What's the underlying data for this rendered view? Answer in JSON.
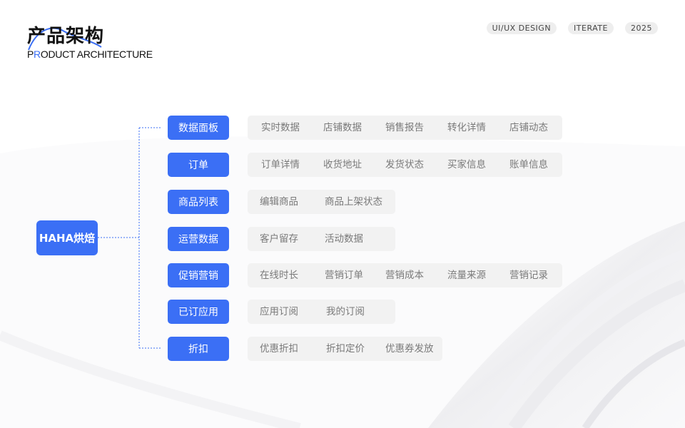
{
  "header": {
    "title_cn": "产品架构",
    "title_en_first": "P",
    "title_en_second": "R",
    "title_en_rest": "ODUCT ARCHITECTURE",
    "tags": [
      "UI/UX DESIGN",
      "ITERATE",
      "2025"
    ]
  },
  "colors": {
    "accent": "#3b6ff5",
    "item_bg": "#f2f2f2",
    "item_text": "#7a7a7a"
  },
  "root": {
    "label": "HAHA烘焙"
  },
  "categories": [
    {
      "label": "数据面板",
      "items": [
        "实时数据",
        "店铺数据",
        "销售报告",
        "转化详情",
        "店铺动态"
      ]
    },
    {
      "label": "订单",
      "items": [
        "订单详情",
        "收货地址",
        "发货状态",
        "买家信息",
        "账单信息"
      ]
    },
    {
      "label": "商品列表",
      "items": [
        "编辑商品",
        "商品上架状态"
      ]
    },
    {
      "label": "运营数据",
      "items": [
        "客户留存",
        "活动数据"
      ]
    },
    {
      "label": "促销营销",
      "items": [
        "在线时长",
        "营销订单",
        "营销成本",
        "流量来源",
        "营销记录"
      ]
    },
    {
      "label": "已订应用",
      "items": [
        "应用订阅",
        "我的订阅"
      ]
    },
    {
      "label": "折扣",
      "items": [
        "优惠折扣",
        "折扣定价",
        "优惠券发放"
      ]
    }
  ]
}
